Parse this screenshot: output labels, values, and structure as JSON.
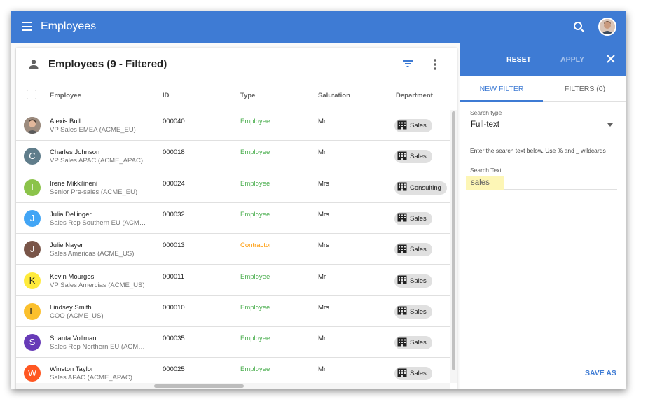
{
  "appbar": {
    "title": "Employees"
  },
  "grid": {
    "title": "Employees (9 - Filtered)",
    "columns": {
      "employee": "Employee",
      "id": "ID",
      "type": "Type",
      "salutation": "Salutation",
      "department": "Department"
    },
    "rows": [
      {
        "initial": "",
        "avatar_color": "#8a7b70",
        "name": "Alexis Bull",
        "sub": "VP Sales EMEA (ACME_EU)",
        "id": "000040",
        "type": "Employee",
        "type_color": "#4caf50",
        "salutation": "Mr",
        "department": "Sales"
      },
      {
        "initial": "C",
        "avatar_color": "#607d8b",
        "name": "Charles Johnson",
        "sub": "VP Sales APAC (ACME_APAC)",
        "id": "000018",
        "type": "Employee",
        "type_color": "#4caf50",
        "salutation": "Mr",
        "department": "Sales"
      },
      {
        "initial": "I",
        "avatar_color": "#8bc34a",
        "name": "Irene Mikkilineni",
        "sub": "Senior Pre-sales (ACME_EU)",
        "id": "000024",
        "type": "Employee",
        "type_color": "#4caf50",
        "salutation": "Mrs",
        "department": "Consulting"
      },
      {
        "initial": "J",
        "avatar_color": "#42a5f5",
        "name": "Julia Dellinger",
        "sub": "Sales Rep Southern EU (ACME…",
        "id": "000032",
        "type": "Employee",
        "type_color": "#4caf50",
        "salutation": "Mrs",
        "department": "Sales"
      },
      {
        "initial": "J",
        "avatar_color": "#795548",
        "name": "Julie Nayer",
        "sub": "Sales Americas (ACME_US)",
        "id": "000013",
        "type": "Contractor",
        "type_color": "#ff9800",
        "salutation": "Mrs",
        "department": "Sales"
      },
      {
        "initial": "K",
        "avatar_color": "#ffeb3b",
        "name": "Kevin Mourgos",
        "sub": "VP Sales Amercias (ACME_US)",
        "id": "000011",
        "type": "Employee",
        "type_color": "#4caf50",
        "salutation": "Mr",
        "department": "Sales"
      },
      {
        "initial": "L",
        "avatar_color": "#fbc02d",
        "name": "Lindsey Smith",
        "sub": "COO (ACME_US)",
        "id": "000010",
        "type": "Employee",
        "type_color": "#4caf50",
        "salutation": "Mrs",
        "department": "Sales"
      },
      {
        "initial": "S",
        "avatar_color": "#673ab7",
        "name": "Shanta Vollman",
        "sub": "Sales Rep Northern EU (ACME…",
        "id": "000035",
        "type": "Employee",
        "type_color": "#4caf50",
        "salutation": "Mr",
        "department": "Sales"
      },
      {
        "initial": "W",
        "avatar_color": "#ff5722",
        "name": "Winston Taylor",
        "sub": "Sales APAC (ACME_APAC)",
        "id": "000025",
        "type": "Employee",
        "type_color": "#4caf50",
        "salutation": "Mr",
        "department": "Sales"
      }
    ]
  },
  "panel": {
    "reset": "RESET",
    "apply": "APPLY",
    "tabs": {
      "new_filter": "NEW FILTER",
      "filters": "FILTERS (0)"
    },
    "search_type_label": "Search type",
    "search_type_value": "Full-text",
    "hint": "Enter the search text below. Use % and _ wildcards",
    "search_text_label": "Search Text",
    "search_text_value": "sales",
    "save_as": "SAVE AS"
  },
  "colors": {
    "primary": "#3e7bd4",
    "employee": "#4caf50",
    "contractor": "#ff9800",
    "highlight": "#fdf6b6"
  },
  "icons": [
    "menu-icon",
    "search-icon",
    "user-avatar",
    "person-icon",
    "filter-icon",
    "more-vert-icon",
    "building-icon",
    "close-icon",
    "dropdown-arrow-icon"
  ]
}
